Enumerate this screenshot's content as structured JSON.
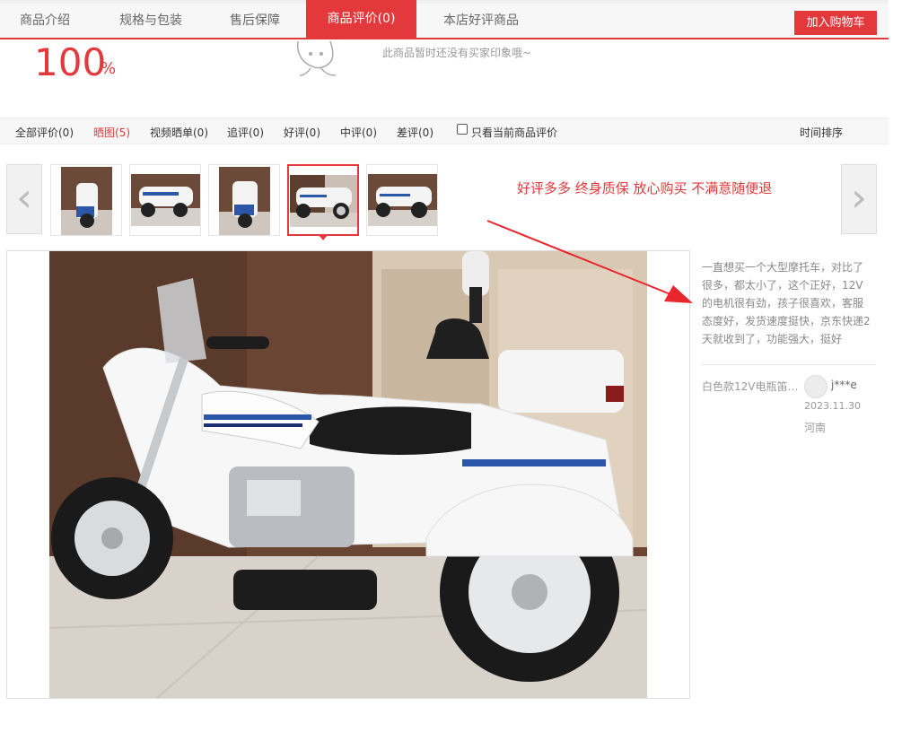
{
  "tabs": {
    "intro": "商品介绍",
    "spec": "规格与包装",
    "after_sale": "售后保障",
    "review": "商品评价(0)",
    "store_good": "本店好评商品"
  },
  "cart_button": "加入购物车",
  "rating": {
    "value": "100",
    "unit": "%"
  },
  "empty_impression": "此商品暂时还没有买家印象哦~",
  "filters": {
    "all": "全部评价(0)",
    "pics": "晒图(5)",
    "video": "视频晒单(0)",
    "follow": "追评(0)",
    "good": "好评(0)",
    "mid": "中评(0)",
    "bad": "差评(0)",
    "current_only": "只看当前商品评价",
    "sort": "时间排序"
  },
  "promo_text": "好评多多 终身质保 放心购买 不满意随便退",
  "review": {
    "text": "一直想买一个大型摩托车，对比了很多，都太小了，这个正好，12V的电机很有劲，孩子很喜欢，客服态度好，发货速度挺快，京东快递2天就收到了，功能强大，挺好",
    "variant": "白色款12V电瓶笛…",
    "user": "j***e",
    "date": "2023.11.30",
    "region": "河南"
  },
  "icons": {
    "prev": "chevron-left-icon",
    "next": "chevron-right-icon"
  },
  "colors": {
    "accent": "#e4393c"
  }
}
